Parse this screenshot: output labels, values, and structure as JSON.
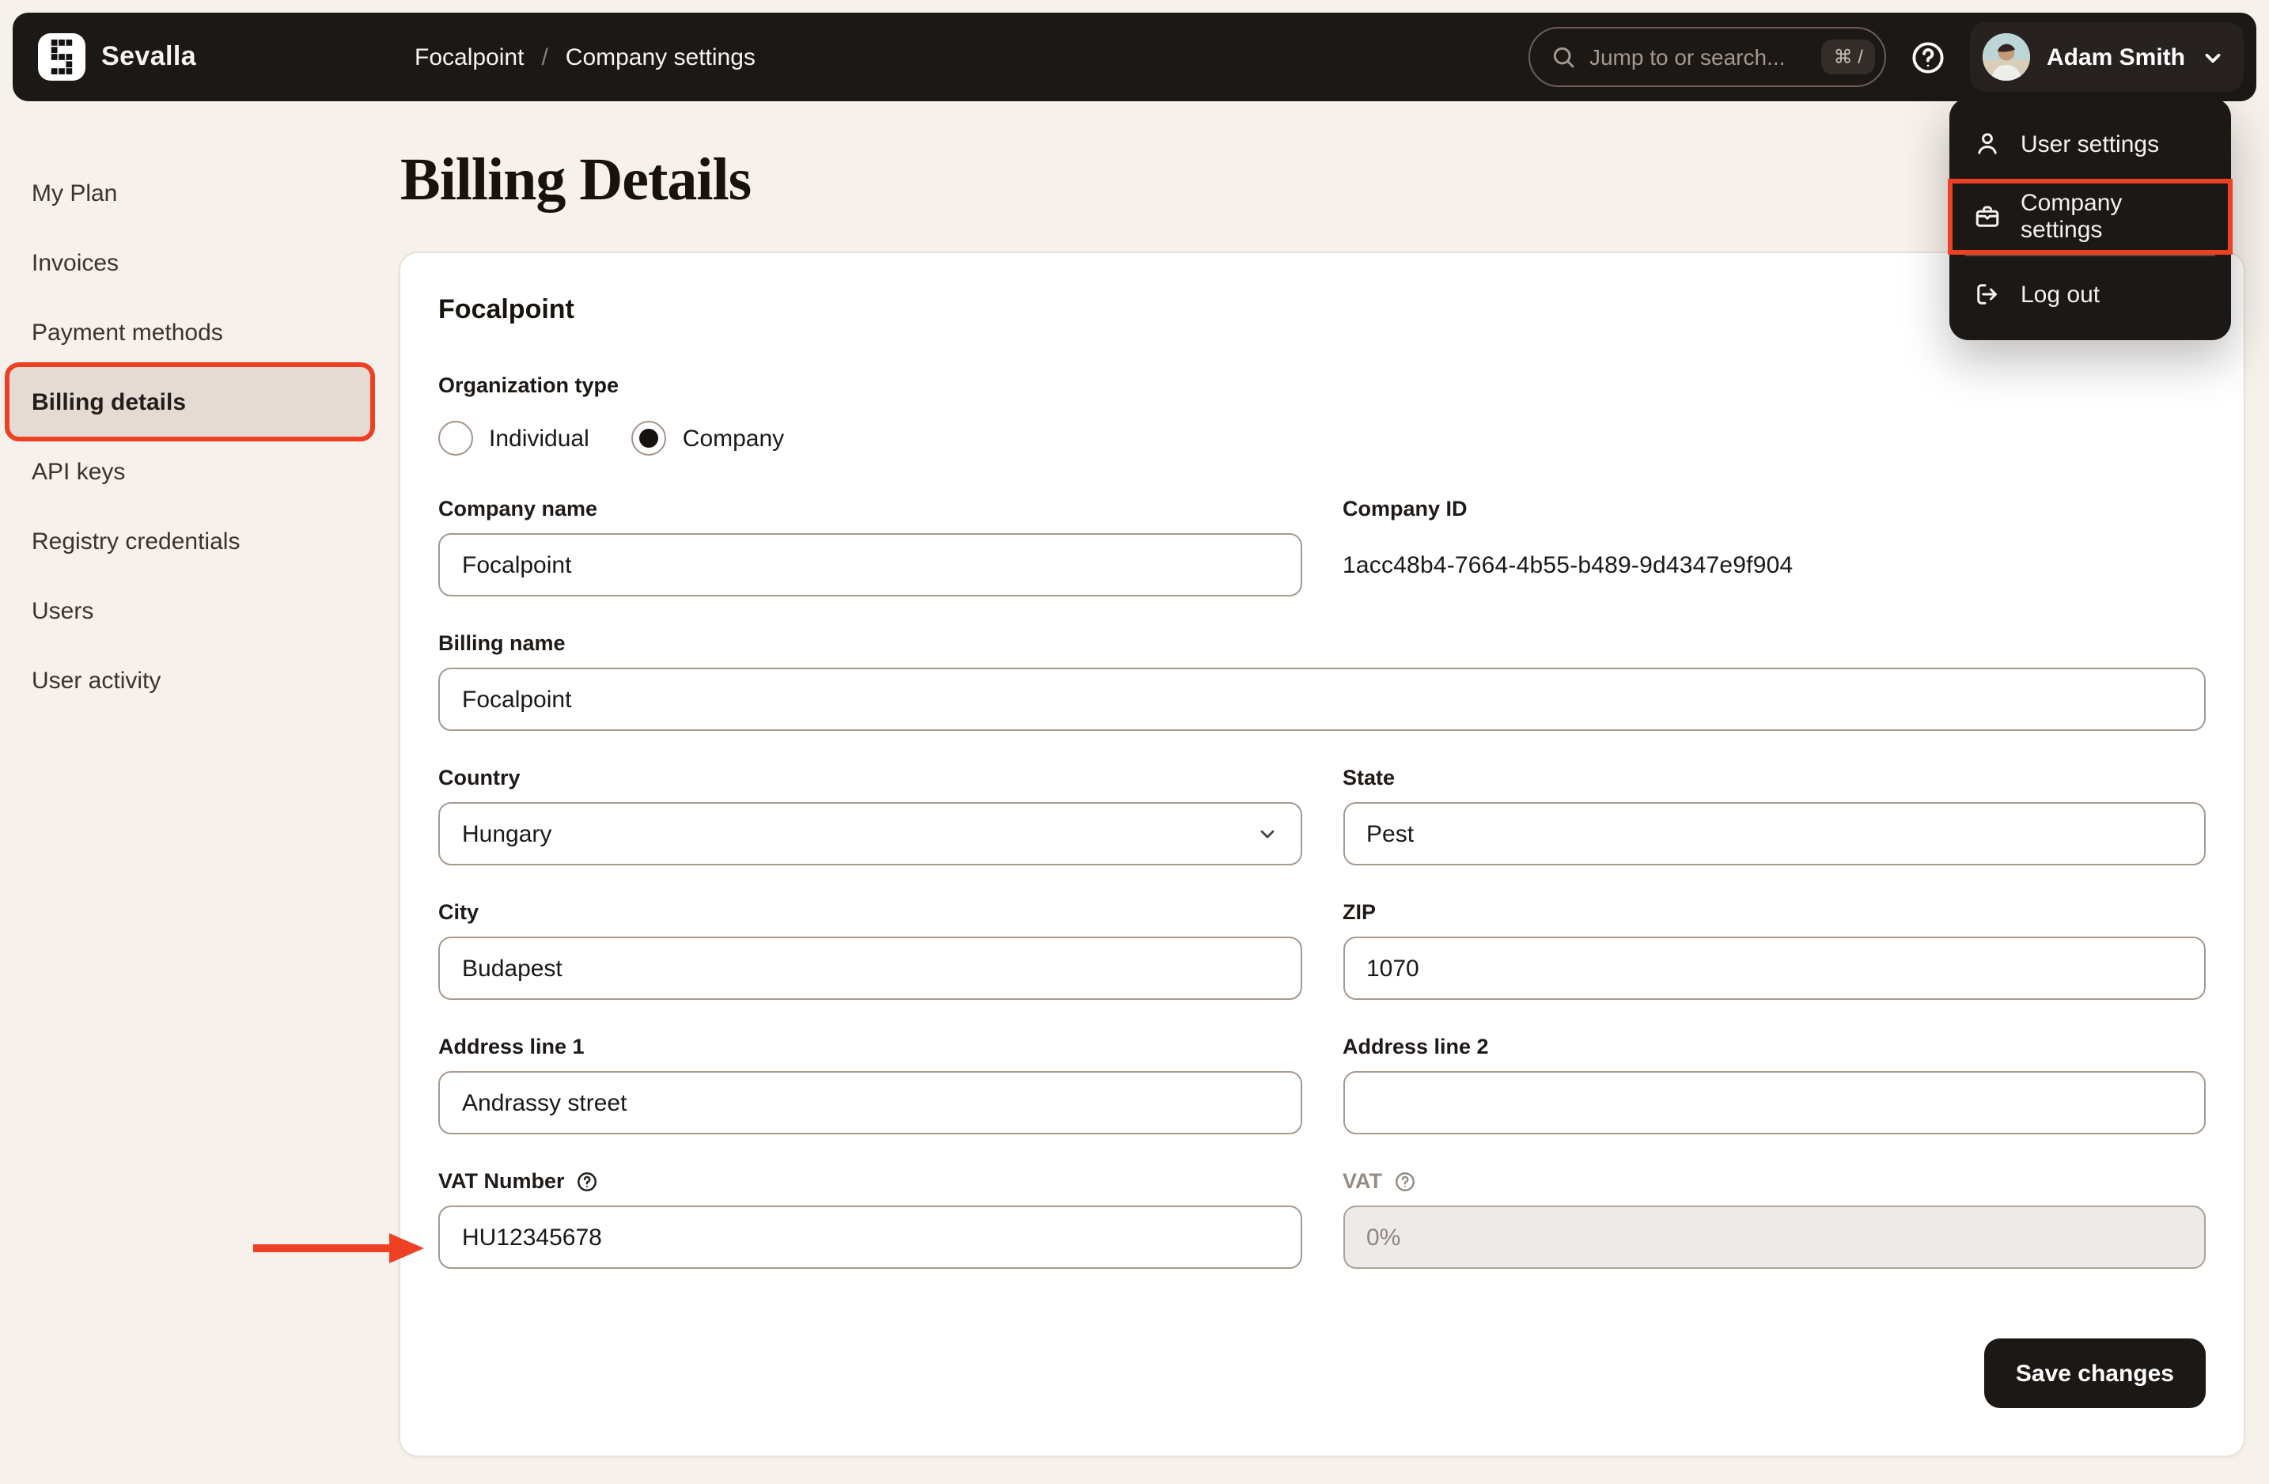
{
  "topbar": {
    "brand": "Sevalla",
    "breadcrumb": {
      "project": "Focalpoint",
      "separator": "/",
      "page": "Company settings"
    },
    "search": {
      "placeholder": "Jump to or search...",
      "shortcut": "⌘ /",
      "icon": "search-icon"
    },
    "help_icon": "question-circle-icon",
    "user": {
      "name": "Adam Smith",
      "avatar_icon": "user-photo-avatar",
      "chevron_icon": "chevron-down-icon"
    }
  },
  "user_menu": {
    "items": [
      {
        "label": "User settings",
        "icon": "user-icon",
        "highlighted": false
      },
      {
        "label": "Company settings",
        "icon": "briefcase-icon",
        "highlighted": true
      },
      {
        "label": "Log out",
        "icon": "logout-icon",
        "highlighted": false
      }
    ]
  },
  "sidebar": {
    "items": [
      {
        "label": "My Plan",
        "active": false
      },
      {
        "label": "Invoices",
        "active": false
      },
      {
        "label": "Payment methods",
        "active": false
      },
      {
        "label": "Billing details",
        "active": true
      },
      {
        "label": "API keys",
        "active": false
      },
      {
        "label": "Registry credentials",
        "active": false
      },
      {
        "label": "Users",
        "active": false
      },
      {
        "label": "User activity",
        "active": false
      }
    ]
  },
  "page": {
    "title": "Billing Details",
    "card": {
      "heading": "Focalpoint",
      "organization_type": {
        "label": "Organization type",
        "options": [
          {
            "label": "Individual",
            "selected": false
          },
          {
            "label": "Company",
            "selected": true
          }
        ]
      },
      "fields": {
        "company_name": {
          "label": "Company name",
          "value": "Focalpoint"
        },
        "company_id": {
          "label": "Company ID",
          "value": "1acc48b4-7664-4b55-b489-9d4347e9f904"
        },
        "billing_name": {
          "label": "Billing name",
          "value": "Focalpoint"
        },
        "country": {
          "label": "Country",
          "value": "Hungary"
        },
        "state": {
          "label": "State",
          "value": "Pest"
        },
        "city": {
          "label": "City",
          "value": "Budapest"
        },
        "zip": {
          "label": "ZIP",
          "value": "1070"
        },
        "address1": {
          "label": "Address line 1",
          "value": "Andrassy street"
        },
        "address2": {
          "label": "Address line 2",
          "value": ""
        },
        "vat_number": {
          "label": "VAT Number",
          "value": "HU12345678",
          "help_icon": "question-circle-icon"
        },
        "vat": {
          "label": "VAT",
          "value": "0%",
          "disabled": true,
          "help_icon": "question-circle-icon"
        }
      },
      "save_label": "Save changes"
    }
  },
  "annotations": {
    "arrow_target": "vat-number-input",
    "highlight_color": "#ee4023"
  },
  "colors": {
    "topbar_bg": "#1c1816",
    "page_bg": "#f7f1ec",
    "active_item_bg": "#e5dbd3",
    "annotation_red": "#ee4023",
    "input_border": "#a79a8f"
  }
}
